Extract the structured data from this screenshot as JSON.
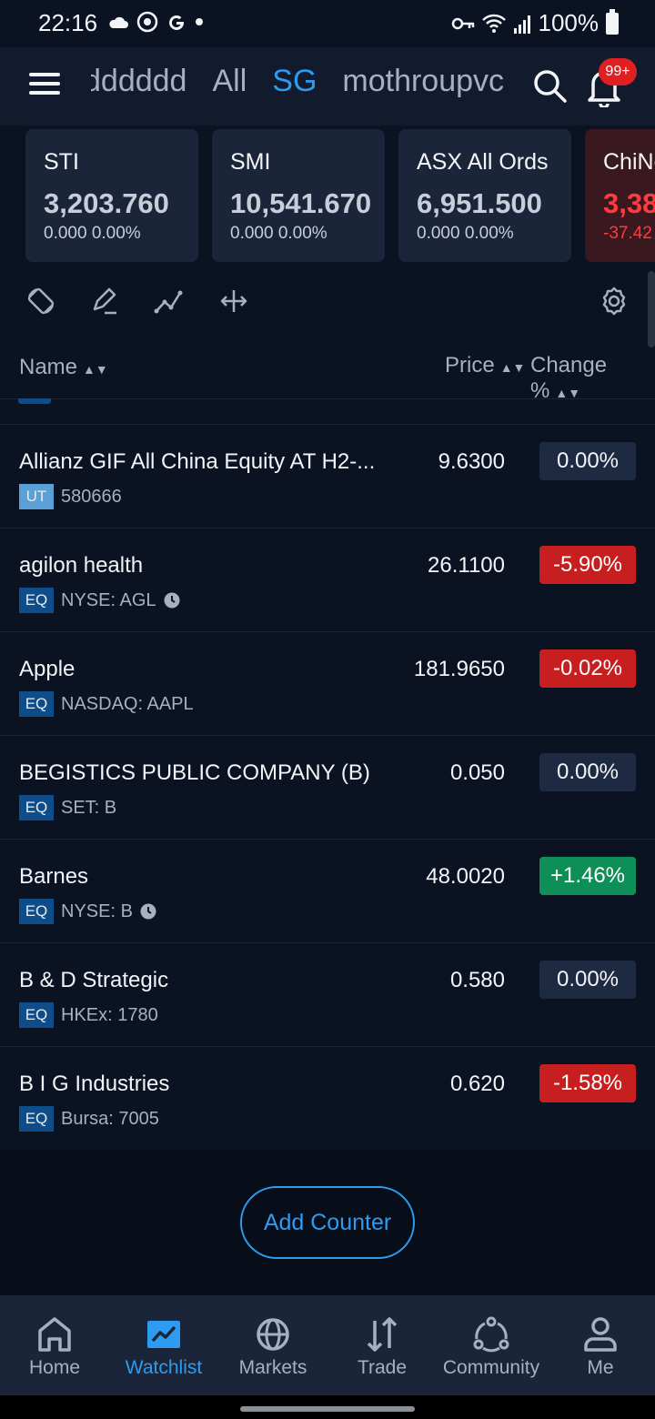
{
  "status_bar": {
    "time": "22:16",
    "battery": "100%"
  },
  "header": {
    "tabs": [
      {
        "label": "dddddd",
        "active": false
      },
      {
        "label": "All",
        "active": false
      },
      {
        "label": "SG",
        "active": true
      },
      {
        "label": "mothroupvc",
        "active": false
      }
    ],
    "notification_badge": "99+"
  },
  "indices": [
    {
      "name": "STI",
      "price": "3,203.760",
      "change": "0.000 0.00%"
    },
    {
      "name": "SMI",
      "price": "10,541.670",
      "change": "0.000 0.00%"
    },
    {
      "name": "ASX All Ords",
      "price": "6,951.500",
      "change": "0.000 0.00%"
    },
    {
      "name": "ChiNe",
      "price": "3,38",
      "change": "-37.42"
    }
  ],
  "columns": {
    "name": "Name",
    "price": "Price",
    "change": "Change %"
  },
  "rows": [
    {
      "name": "Allianz GIF All China Equity AT H2-...",
      "tag": "UT",
      "code": "580666",
      "clock": false,
      "price": "9.6300",
      "change": "0.00%",
      "dir": "flat"
    },
    {
      "name": "agilon health",
      "tag": "EQ",
      "code": "NYSE: AGL",
      "clock": true,
      "price": "26.1100",
      "change": "-5.90%",
      "dir": "neg"
    },
    {
      "name": "Apple",
      "tag": "EQ",
      "code": "NASDAQ: AAPL",
      "clock": false,
      "price": "181.9650",
      "change": "-0.02%",
      "dir": "neg"
    },
    {
      "name": "BEGISTICS PUBLIC COMPANY (B)",
      "tag": "EQ",
      "code": "SET: B",
      "clock": false,
      "price": "0.050",
      "change": "0.00%",
      "dir": "flat"
    },
    {
      "name": "Barnes",
      "tag": "EQ",
      "code": "NYSE: B",
      "clock": true,
      "price": "48.0020",
      "change": "+1.46%",
      "dir": "pos"
    },
    {
      "name": "B & D Strategic",
      "tag": "EQ",
      "code": "HKEx: 1780",
      "clock": false,
      "price": "0.580",
      "change": "0.00%",
      "dir": "flat"
    },
    {
      "name": "B I G Industries",
      "tag": "EQ",
      "code": "Bursa: 7005",
      "clock": false,
      "price": "0.620",
      "change": "-1.58%",
      "dir": "neg"
    }
  ],
  "add_counter_label": "Add Counter",
  "nav": [
    {
      "label": "Home",
      "icon": "home-icon",
      "active": false
    },
    {
      "label": "Watchlist",
      "icon": "watchlist-icon",
      "active": true
    },
    {
      "label": "Markets",
      "icon": "globe-icon",
      "active": false
    },
    {
      "label": "Trade",
      "icon": "trade-arrows-icon",
      "active": false
    },
    {
      "label": "Community",
      "icon": "community-icon",
      "active": false
    },
    {
      "label": "Me",
      "icon": "person-icon",
      "active": false
    }
  ],
  "colors": {
    "accent": "#2d9bf0",
    "negative": "#c71f1f",
    "positive": "#0f8f58",
    "background": "#0b1222"
  }
}
